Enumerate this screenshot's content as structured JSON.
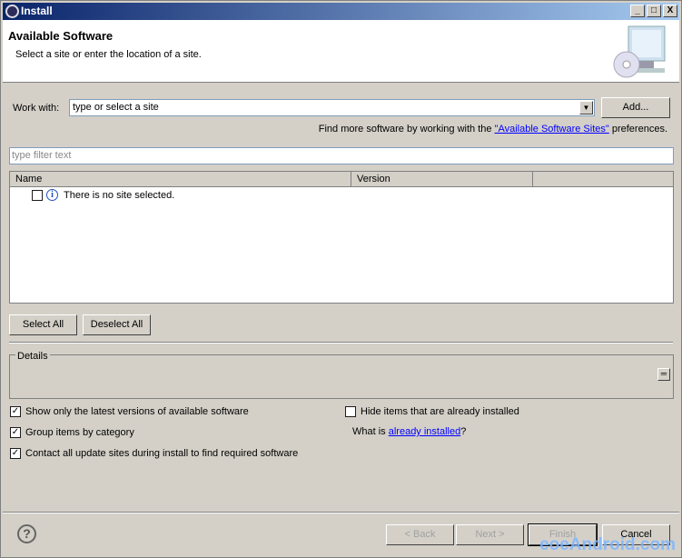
{
  "window": {
    "title": "Install",
    "minimize": "_",
    "maximize": "□",
    "close": "X"
  },
  "header": {
    "title": "Available Software",
    "description": "Select a site or enter the location of a site."
  },
  "work_with": {
    "label": "Work with:",
    "value": "type or select a site",
    "add_button": "Add..."
  },
  "find_more": {
    "prefix": "Find more software by working with the ",
    "link": "\"Available Software Sites\"",
    "suffix": " preferences."
  },
  "filter": {
    "placeholder": "type filter text"
  },
  "table": {
    "columns": [
      "Name",
      "Version"
    ],
    "rows": [
      {
        "text": "There is no site selected.",
        "checked": false,
        "icon": "info-icon"
      }
    ]
  },
  "buttons": {
    "select_all": "Select All",
    "deselect_all": "Deselect All"
  },
  "details": {
    "label": "Details"
  },
  "options": {
    "latest": {
      "label": "Show only the latest versions of available software",
      "checked": true
    },
    "group": {
      "label": "Group items by category",
      "checked": true
    },
    "contact": {
      "label": "Contact all update sites during install to find required software",
      "checked": true
    },
    "hide": {
      "label": "Hide items that are already installed",
      "checked": false
    },
    "what_is_prefix": "What is ",
    "already_installed": "already installed",
    "what_is_suffix": "?"
  },
  "footer": {
    "help": "?",
    "back": "< Back",
    "next": "Next >",
    "finish": "Finish",
    "cancel": "Cancel"
  },
  "watermark": "eoeAndroid.com"
}
